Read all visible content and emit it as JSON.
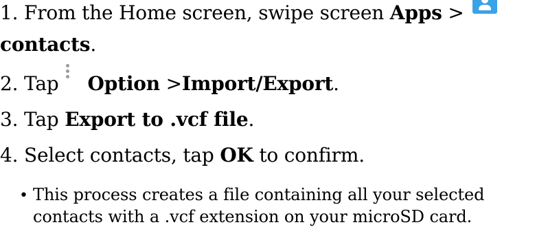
{
  "steps": {
    "step1": {
      "prefix": "1. From the Home screen, swipe screen ",
      "apps": "Apps",
      "sep": " >",
      "icon": "contacts-app-icon",
      "contacts": "contacts",
      "end": "."
    },
    "step2": {
      "prefix": "2. Tap",
      "icon": "more-options-icon",
      "option": "Option",
      "sep": " >",
      "import_export": "Import/Export",
      "end": "."
    },
    "step3": {
      "prefix": "3. Tap ",
      "export": "Export to .vcf file",
      "end": "."
    },
    "step4": {
      "prefix": "4. Select contacts, tap ",
      "ok": "OK",
      "suffix": " to confirm."
    }
  },
  "note": {
    "bullet": "•",
    "line1": "This process creates a file containing all your selected",
    "line2": "contacts with a .vcf extension on your microSD card."
  },
  "colors": {
    "contacts_icon": "#3aa2e6",
    "menu_icon": "#9a9a9a",
    "text": "#000000"
  }
}
